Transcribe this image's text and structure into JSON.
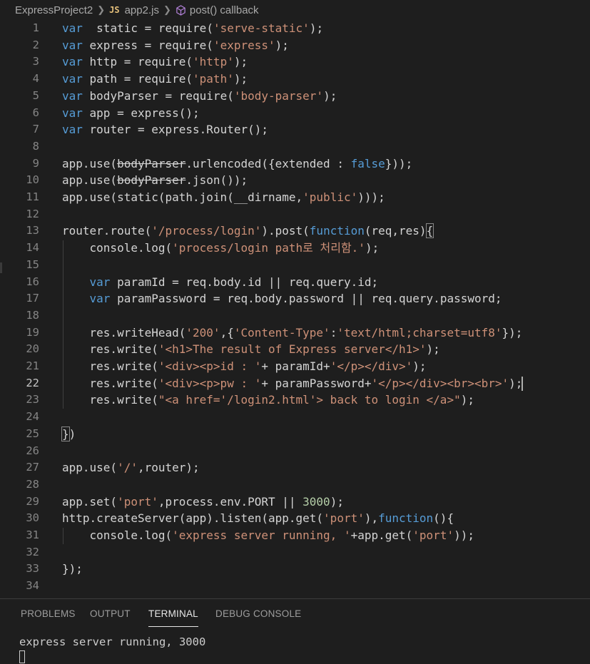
{
  "breadcrumb": {
    "project": "ExpressProject2",
    "file_badge": "JS",
    "file": "app2.js",
    "symbol": "post() callback"
  },
  "editor": {
    "current_line": 22,
    "lines": [
      {
        "n": "1",
        "tokens": [
          [
            "kw",
            "var"
          ],
          [
            "",
            "  static = "
          ],
          [
            "",
            "require"
          ],
          [
            "",
            "("
          ],
          [
            "str",
            "'serve-static'"
          ],
          [
            "",
            ");"
          ]
        ]
      },
      {
        "n": "2",
        "tokens": [
          [
            "kw",
            "var"
          ],
          [
            "",
            " express = require("
          ],
          [
            "str",
            "'express'"
          ],
          [
            "",
            ");"
          ]
        ]
      },
      {
        "n": "3",
        "tokens": [
          [
            "kw",
            "var"
          ],
          [
            "",
            " http = require("
          ],
          [
            "str",
            "'http'"
          ],
          [
            "",
            ");"
          ]
        ]
      },
      {
        "n": "4",
        "tokens": [
          [
            "kw",
            "var"
          ],
          [
            "",
            " path = require("
          ],
          [
            "str",
            "'path'"
          ],
          [
            "",
            ");"
          ]
        ]
      },
      {
        "n": "5",
        "tokens": [
          [
            "kw",
            "var"
          ],
          [
            "",
            " bodyParser = require("
          ],
          [
            "str",
            "'body-parser'"
          ],
          [
            "",
            ");"
          ]
        ]
      },
      {
        "n": "6",
        "tokens": [
          [
            "kw",
            "var"
          ],
          [
            "",
            " app = express();"
          ]
        ]
      },
      {
        "n": "7",
        "tokens": [
          [
            "kw",
            "var"
          ],
          [
            "",
            " router = express.Router();"
          ]
        ]
      },
      {
        "n": "8",
        "tokens": []
      },
      {
        "n": "9",
        "tokens": [
          [
            "",
            "app.use("
          ],
          [
            "strike",
            "bodyParser"
          ],
          [
            "",
            ".urlencoded({extended : "
          ],
          [
            "kw",
            "false"
          ],
          [
            "",
            "}));"
          ]
        ]
      },
      {
        "n": "10",
        "tokens": [
          [
            "",
            "app.use("
          ],
          [
            "strike",
            "bodyParser"
          ],
          [
            "",
            ".json());"
          ]
        ]
      },
      {
        "n": "11",
        "tokens": [
          [
            "",
            "app.use(static(path.join(__dirname,"
          ],
          [
            "str",
            "'public'"
          ],
          [
            "",
            ")));"
          ]
        ]
      },
      {
        "n": "12",
        "tokens": []
      },
      {
        "n": "13",
        "tokens": [
          [
            "",
            "router.route("
          ],
          [
            "str",
            "'/process/login'"
          ],
          [
            "",
            ").post("
          ],
          [
            "kw",
            "function"
          ],
          [
            "",
            "(req,res)"
          ],
          [
            "bracket",
            "{"
          ]
        ]
      },
      {
        "n": "14",
        "tokens": [
          [
            "",
            "    console.log("
          ],
          [
            "str",
            "'process/login path로 처리함.'"
          ],
          [
            "",
            ");"
          ]
        ]
      },
      {
        "n": "15",
        "tokens": []
      },
      {
        "n": "16",
        "tokens": [
          [
            "",
            "    "
          ],
          [
            "kw",
            "var"
          ],
          [
            "",
            " paramId = req.body.id || req.query.id;"
          ]
        ]
      },
      {
        "n": "17",
        "tokens": [
          [
            "",
            "    "
          ],
          [
            "kw",
            "var"
          ],
          [
            "",
            " paramPassword = req.body.password || req.query.password;"
          ]
        ]
      },
      {
        "n": "18",
        "tokens": []
      },
      {
        "n": "19",
        "tokens": [
          [
            "",
            "    res.writeHead("
          ],
          [
            "str",
            "'200'"
          ],
          [
            "",
            ",{"
          ],
          [
            "str",
            "'Content-Type'"
          ],
          [
            "",
            ":"
          ],
          [
            "str",
            "'text/html;charset=utf8'"
          ],
          [
            "",
            "});"
          ]
        ]
      },
      {
        "n": "20",
        "tokens": [
          [
            "",
            "    res.write("
          ],
          [
            "str",
            "'<h1>The result of Express server</h1>'"
          ],
          [
            "",
            ");"
          ]
        ]
      },
      {
        "n": "21",
        "tokens": [
          [
            "",
            "    res.write("
          ],
          [
            "str",
            "'<div><p>id : '"
          ],
          [
            "",
            "+ paramId+"
          ],
          [
            "str",
            "'</p></div>'"
          ],
          [
            "",
            ");"
          ]
        ]
      },
      {
        "n": "22",
        "tokens": [
          [
            "",
            "    res.write("
          ],
          [
            "str",
            "'<div><p>pw : '"
          ],
          [
            "",
            "+ paramPassword+"
          ],
          [
            "str",
            "'</p></div><br><br>'"
          ],
          [
            "",
            ");"
          ]
        ]
      },
      {
        "n": "23",
        "tokens": [
          [
            "",
            "    res.write("
          ],
          [
            "str",
            "\"<a href='/login2.html'> back to login </a>\""
          ],
          [
            "",
            ");"
          ]
        ]
      },
      {
        "n": "24",
        "tokens": []
      },
      {
        "n": "25",
        "tokens": [
          [
            "bracket",
            "}"
          ],
          [
            "",
            ")"
          ]
        ]
      },
      {
        "n": "26",
        "tokens": []
      },
      {
        "n": "27",
        "tokens": [
          [
            "",
            "app.use("
          ],
          [
            "str",
            "'/'"
          ],
          [
            "",
            ",router);"
          ]
        ]
      },
      {
        "n": "28",
        "tokens": []
      },
      {
        "n": "29",
        "tokens": [
          [
            "",
            "app.set("
          ],
          [
            "str",
            "'port'"
          ],
          [
            "",
            ",process.env.PORT || "
          ],
          [
            "num",
            "3000"
          ],
          [
            "",
            ");"
          ]
        ]
      },
      {
        "n": "30",
        "tokens": [
          [
            "",
            "http.createServer(app).listen(app.get("
          ],
          [
            "str",
            "'port'"
          ],
          [
            "",
            "),"
          ],
          [
            "kw",
            "function"
          ],
          [
            "",
            "(){"
          ]
        ]
      },
      {
        "n": "31",
        "tokens": [
          [
            "",
            "    console.log("
          ],
          [
            "str",
            "'express server running, '"
          ],
          [
            "",
            "+app.get("
          ],
          [
            "str",
            "'port'"
          ],
          [
            "",
            "));"
          ]
        ]
      },
      {
        "n": "32",
        "tokens": []
      },
      {
        "n": "33",
        "tokens": [
          [
            "",
            "});"
          ]
        ]
      },
      {
        "n": "34",
        "tokens": []
      }
    ]
  },
  "panel": {
    "tabs": [
      "PROBLEMS",
      "OUTPUT",
      "TERMINAL",
      "DEBUG CONSOLE"
    ],
    "active_tab": "TERMINAL",
    "terminal_output": "express server running, 3000"
  },
  "colors": {
    "background": "#1e1e1e",
    "keyword": "#569cd6",
    "string": "#ce9178",
    "number": "#b5cea8",
    "text": "#d4d4d4"
  }
}
